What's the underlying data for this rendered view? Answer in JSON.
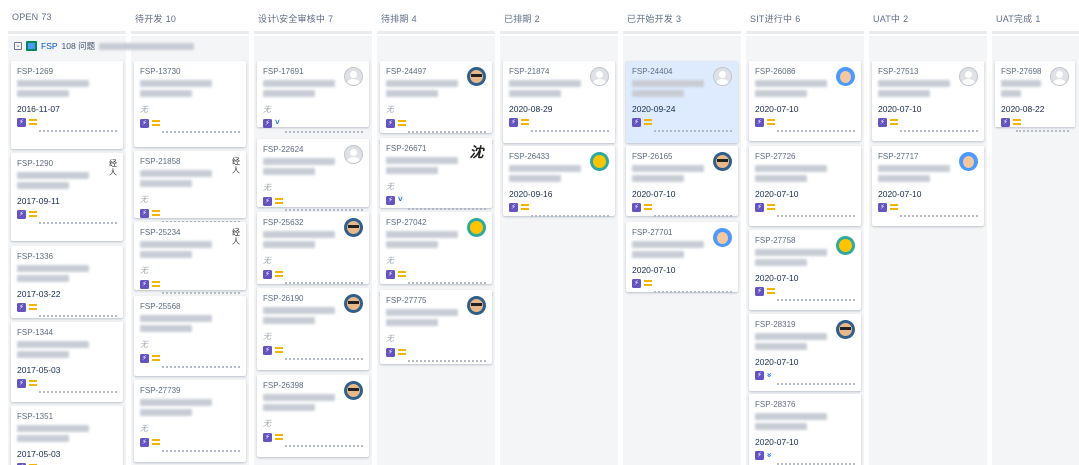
{
  "columns": [
    {
      "name": "OPEN",
      "count": "73"
    },
    {
      "name": "待开发",
      "count": "10"
    },
    {
      "name": "设计\\安全审核中",
      "count": "7"
    },
    {
      "name": "待排期",
      "count": "4"
    },
    {
      "name": "已排期",
      "count": "2"
    },
    {
      "name": "已开始开发",
      "count": "3"
    },
    {
      "name": "SIT进行中",
      "count": "6"
    },
    {
      "name": "UAT中",
      "count": "2"
    },
    {
      "name": "UAT完成",
      "count": "1"
    }
  ],
  "swimlane": {
    "key": "FSP",
    "count_label": "108 问题"
  },
  "no_estimate": "无",
  "issue_type_icon": "story-icon",
  "colors": {
    "story": "#6554c0",
    "medium_priority": "#f4b400",
    "low_priority": "#0065ff",
    "selected_card": "#deebff"
  },
  "cards": {
    "c0": [
      {
        "key": "FSP-1269",
        "date": "2016-11-07"
      },
      {
        "key": "FSP-1290",
        "date": "2017-09-11",
        "avatar_text": "经\n人"
      },
      {
        "key": "FSP-1336",
        "date": "2017-03-22"
      },
      {
        "key": "FSP-1344",
        "date": "2017-05-03"
      },
      {
        "key": "FSP-1351",
        "date": "2017-05-03"
      }
    ],
    "c1": [
      {
        "key": "FSP-13730"
      },
      {
        "key": "FSP-21858",
        "avatar_text": "经\n人"
      },
      {
        "key": "FSP-25234",
        "avatar_text": "经\n人"
      },
      {
        "key": "FSP-25568"
      },
      {
        "key": "FSP-27739"
      }
    ],
    "c2": [
      {
        "key": "FSP-17691"
      },
      {
        "key": "FSP-22624"
      },
      {
        "key": "FSP-25632"
      },
      {
        "key": "FSP-26190"
      },
      {
        "key": "FSP-26398"
      }
    ],
    "c3": [
      {
        "key": "FSP-24497"
      },
      {
        "key": "FSP-26671",
        "avatar_text": "沈"
      },
      {
        "key": "FSP-27042"
      },
      {
        "key": "FSP-27775"
      }
    ],
    "c4": [
      {
        "key": "FSP-21874",
        "date": "2020-08-29"
      },
      {
        "key": "FSP-26433",
        "date": "2020-09-16"
      }
    ],
    "c5": [
      {
        "key": "FSP-24404",
        "date": "2020-09-24"
      },
      {
        "key": "FSP-26165",
        "date": "2020-07-10"
      },
      {
        "key": "FSP-27701",
        "date": "2020-07-10"
      }
    ],
    "c6": [
      {
        "key": "FSP-26086",
        "date": "2020-07-10"
      },
      {
        "key": "FSP-27726",
        "date": "2020-07-10"
      },
      {
        "key": "FSP-27758",
        "date": "2020-07-10"
      },
      {
        "key": "FSP-28319",
        "date": "2020-07-10"
      },
      {
        "key": "FSP-28376",
        "date": "2020-07-10"
      }
    ],
    "c7": [
      {
        "key": "FSP-27513",
        "date": "2020-07-10"
      },
      {
        "key": "FSP-27717",
        "date": "2020-07-10"
      }
    ],
    "c8": [
      {
        "key": "FSP-27698",
        "date": "2020-08-22"
      }
    ]
  }
}
